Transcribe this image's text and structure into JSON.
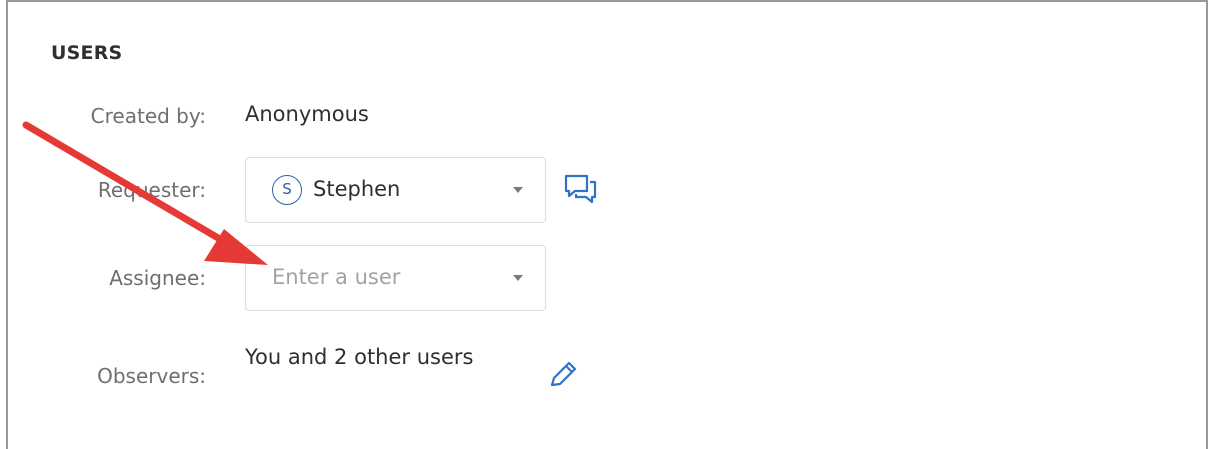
{
  "section": {
    "title": "USERS"
  },
  "fields": {
    "created_by": {
      "label": "Created by:",
      "value": "Anonymous"
    },
    "requester": {
      "label": "Requester:",
      "avatar_initial": "S",
      "value": "Stephen",
      "action_icon": "chat-icon"
    },
    "assignee": {
      "label": "Assignee:",
      "placeholder": "Enter a user"
    },
    "observers": {
      "label": "Observers:",
      "value": "You and 2 other users",
      "action_icon": "pencil-icon"
    }
  },
  "colors": {
    "accent_blue": "#2f5fa7",
    "annotation_red": "#e53935",
    "label_gray": "#6f6f6f",
    "placeholder_gray": "#a3a3a3"
  }
}
